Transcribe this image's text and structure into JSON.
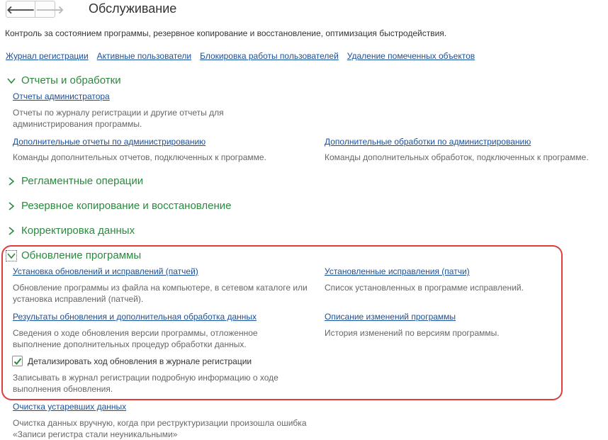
{
  "toolbar": {
    "back_symbol": "🡐",
    "forward_symbol": "🡒"
  },
  "page": {
    "title": "Обслуживание",
    "subtitle": "Контроль за состоянием программы, резервное копирование и восстановление, оптимизация быстродействия."
  },
  "top_links": [
    "Журнал регистрации",
    "Активные пользователи",
    "Блокировка работы пользователей",
    "Удаление помеченных объектов"
  ],
  "sections": {
    "reports": {
      "title": "Отчеты и обработки",
      "expanded": true,
      "items": [
        {
          "link": "Отчеты администратора",
          "desc": "Отчеты по журналу регистрации и другие отчеты для администрирования программы."
        },
        {
          "link": "Дополнительные отчеты по администрированию",
          "desc": "Команды дополнительных отчетов, подключенных к программе."
        },
        {
          "link": "Дополнительные обработки по администрированию",
          "desc": "Команды дополнительных обработок, подключенных к программе."
        }
      ]
    },
    "scheduled": {
      "title": "Регламентные операции",
      "expanded": false
    },
    "backup": {
      "title": "Резервное копирование и восстановление",
      "expanded": false
    },
    "correction": {
      "title": "Корректировка данных",
      "expanded": false
    },
    "update": {
      "title": "Обновление программы",
      "expanded": true,
      "items": [
        {
          "link": "Установка обновлений и исправлений (патчей)",
          "desc": "Обновление программы из файла на компьютере, в сетевом каталоге или установка исправлений (патчей)."
        },
        {
          "link": "Установленные исправления (патчи)",
          "desc": "Список установленных в программе исправлений."
        },
        {
          "link": "Результаты обновления и дополнительная обработка данных",
          "desc": "Сведения о ходе обновления версии программы, отложенное выполнение дополнительных процедур обработки данных."
        },
        {
          "link": "Описание изменений программы",
          "desc": "История изменений по версиям программы."
        }
      ],
      "checkbox": {
        "label": "Детализировать ход обновления в журнале регистрации",
        "checked": true,
        "desc": "Записывать в журнал регистрации подробную информацию о ходе выполнения обновления."
      }
    },
    "cleanup": {
      "link": "Очистка устаревших данных",
      "desc": "Очистка данных вручную, когда при реструктуризации произошла ошибка «Записи регистра стали неуникальными»"
    }
  },
  "colors": {
    "section_green": "#2a8a3e",
    "link_blue": "#1a4f9a",
    "highlight_red": "#e03c3c",
    "desc_gray": "#666666"
  },
  "icons": [
    "arrow-left-icon",
    "arrow-right-icon",
    "chevron-down-icon",
    "chevron-right-icon",
    "checkmark-icon"
  ]
}
